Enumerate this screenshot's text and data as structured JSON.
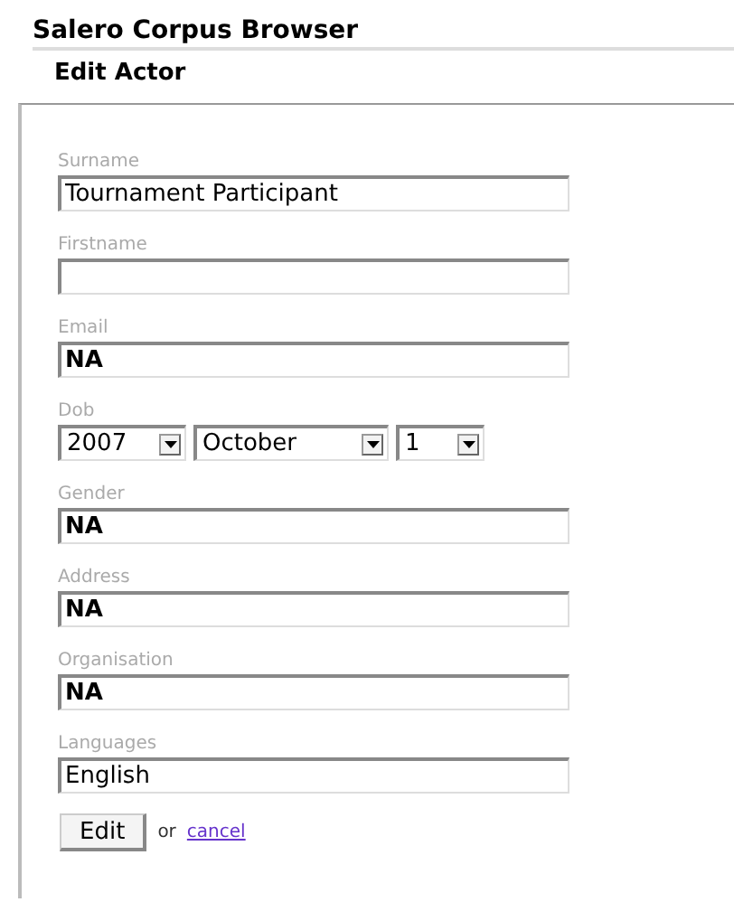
{
  "app_title": "Salero Corpus Browser",
  "page_title": "Edit Actor",
  "fields": [
    {
      "kind": "text",
      "label": "Surname",
      "value": "Tournament Participant",
      "bold": false
    },
    {
      "kind": "text",
      "label": "Firstname"
    },
    {
      "kind": "text",
      "label": "Email",
      "value": "NA",
      "bold": true
    },
    {
      "kind": "date",
      "label": "Dob",
      "selects": [
        {
          "value": "2007"
        },
        {
          "value": "October"
        },
        {
          "value": "1"
        }
      ]
    },
    {
      "kind": "text",
      "label": "Gender",
      "value": "NA",
      "bold": true
    },
    {
      "kind": "text",
      "label": "Address",
      "value": "NA",
      "bold": true
    },
    {
      "kind": "text",
      "label": "Organisation",
      "value": "NA",
      "bold": true
    },
    {
      "kind": "text",
      "label": "Languages",
      "value": "English",
      "bold": false
    }
  ],
  "submit": "Edit",
  "or_text": "or",
  "cancel_link": "cancel"
}
